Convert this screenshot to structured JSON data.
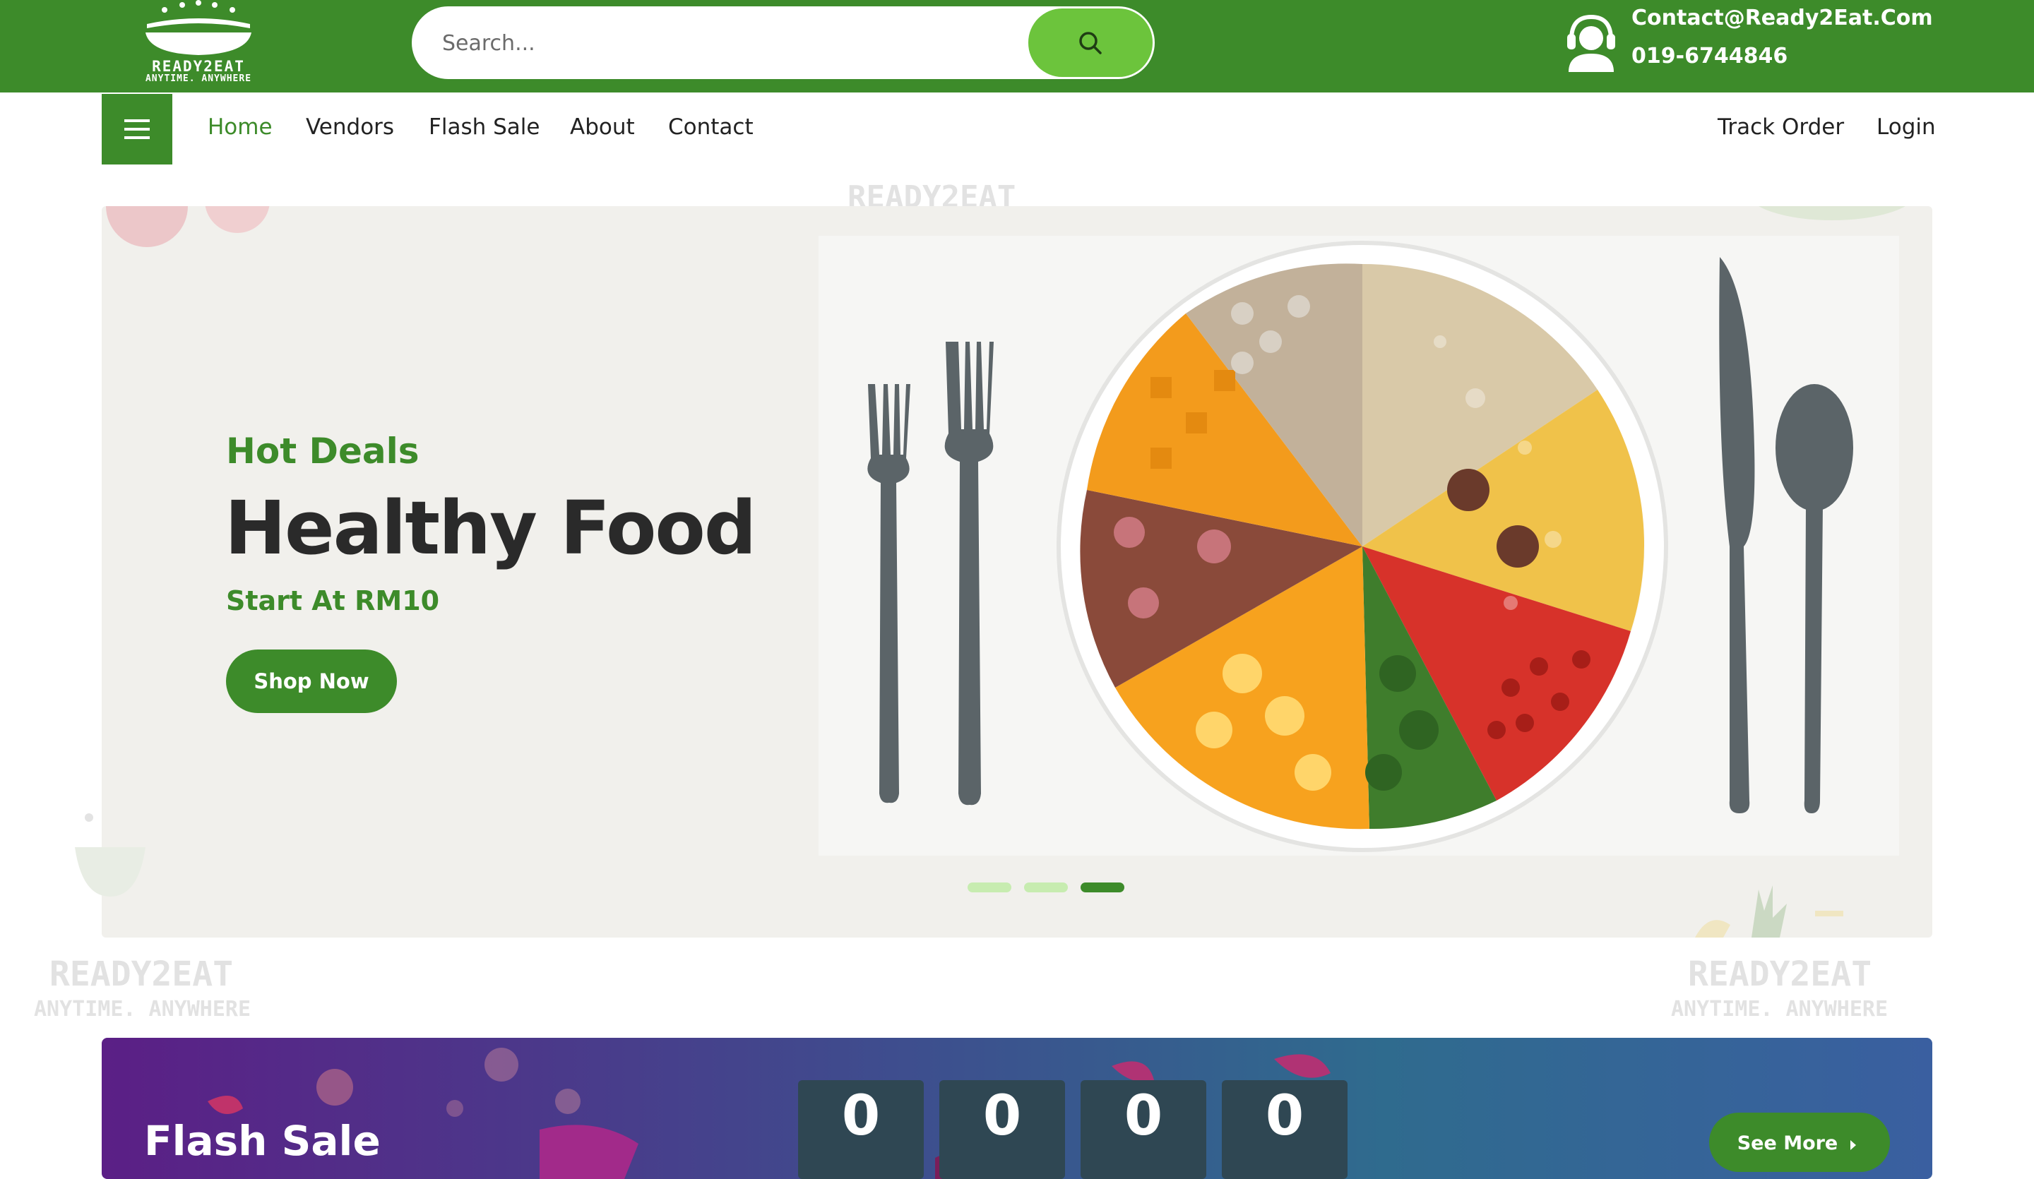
{
  "header": {
    "logo": {
      "brand": "READY2EAT",
      "tagline": "ANYTIME. ANYWHERE"
    },
    "search": {
      "placeholder": "Search..."
    },
    "contact": {
      "email": "Contact@Ready2Eat.Com",
      "phone": "019-6744846"
    }
  },
  "nav": {
    "items": [
      {
        "label": "Home",
        "active": true
      },
      {
        "label": "Vendors"
      },
      {
        "label": "Flash Sale"
      },
      {
        "label": "About"
      },
      {
        "label": "Contact"
      }
    ],
    "right": [
      {
        "label": "Track Order"
      },
      {
        "label": "Login"
      }
    ]
  },
  "hero": {
    "subtitle": "Hot Deals",
    "title": "Healthy Food",
    "price_text": "Start At RM10",
    "cta": "Shop Now",
    "slide_count": 3,
    "active_slide": 3
  },
  "flash_sale": {
    "title": "Flash Sale",
    "countdown": [
      "0",
      "0",
      "0",
      "0"
    ],
    "see_more": "See More"
  },
  "colors": {
    "brand_green": "#3d8b2a",
    "search_button": "#6cc43c",
    "hero_bg": "#f1f0ec"
  }
}
